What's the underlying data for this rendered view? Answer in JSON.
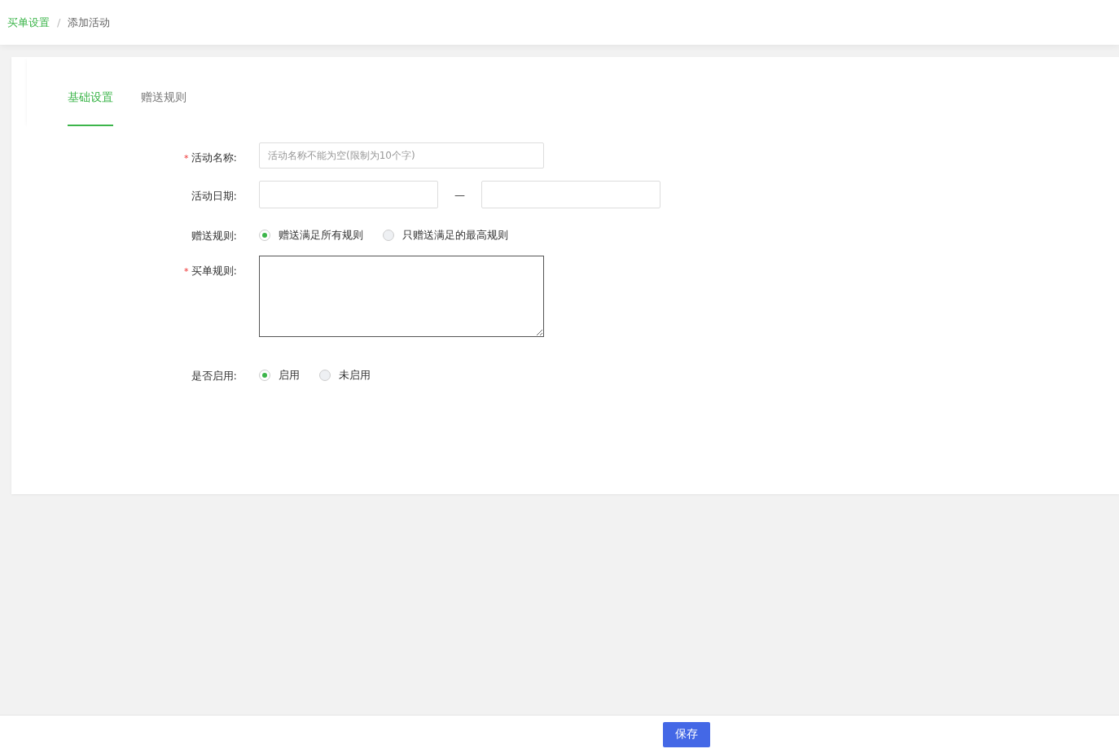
{
  "breadcrumb": [
    {
      "label": "买单设置",
      "selected": false
    },
    {
      "label": "添加活动",
      "selected": true
    }
  ],
  "breadcrumb_separator": "/",
  "tabs": [
    {
      "label": "基础设置",
      "selected": true
    },
    {
      "label": "赠送规则",
      "selected": false
    }
  ],
  "form": [
    {
      "kind": "text",
      "label": "活动名称:",
      "required": true,
      "placeholder": "活动名称不能为空(限制为10个字)"
    },
    {
      "kind": "daterange",
      "label": "活动日期:",
      "required": false,
      "separator": "—"
    },
    {
      "kind": "radio",
      "label": "赠送规则:",
      "required": false,
      "options": [
        {
          "label": "赠送满足所有规则",
          "selected": true
        },
        {
          "label": "只赠送满足的最高规则",
          "selected": false
        }
      ]
    },
    {
      "kind": "textarea",
      "label": "买单规则:",
      "required": true
    },
    {
      "kind": "radio",
      "label": "是否启用:",
      "required": false,
      "options": [
        {
          "label": "启用",
          "selected": true
        },
        {
          "label": "未启用",
          "selected": false
        }
      ]
    }
  ],
  "required_mark": "*",
  "save_button": "保存"
}
